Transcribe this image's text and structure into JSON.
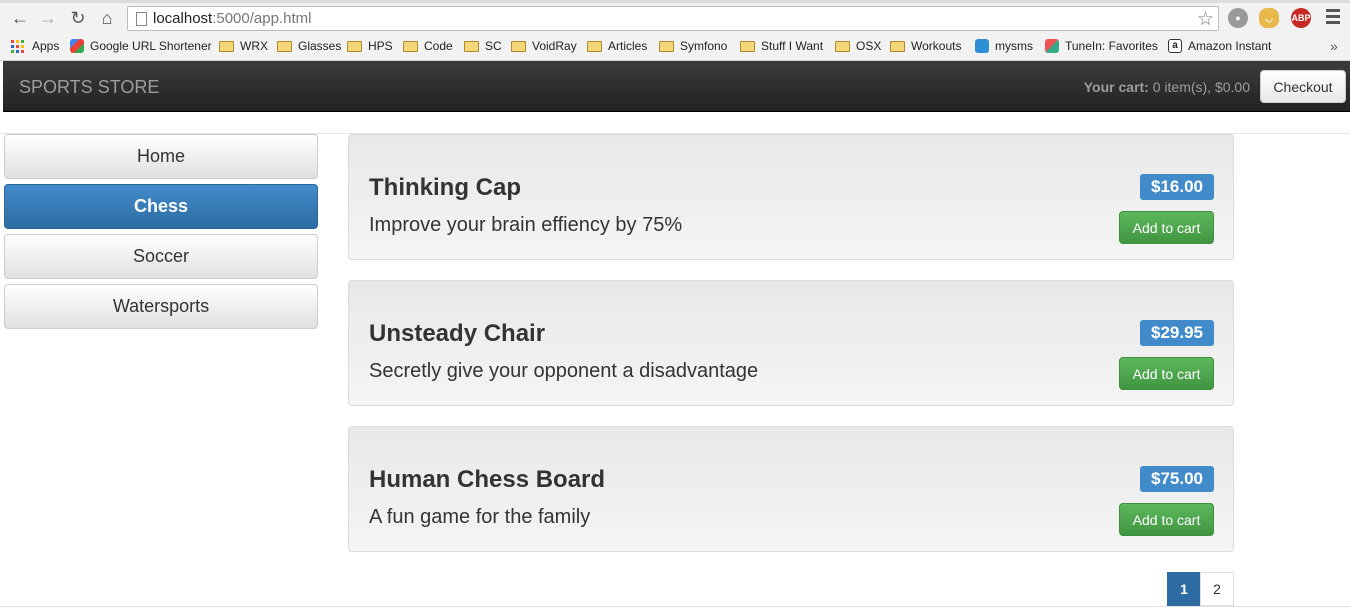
{
  "browser": {
    "url_host": "localhost",
    "url_path": ":5000/app.html",
    "bookmarks": [
      {
        "label": "Apps",
        "icon": "apps-grid-icon"
      },
      {
        "label": "Google URL Shortener",
        "icon": "google-icon"
      },
      {
        "label": "WRX",
        "icon": "folder-icon"
      },
      {
        "label": "Glasses",
        "icon": "folder-icon"
      },
      {
        "label": "HPS",
        "icon": "folder-icon"
      },
      {
        "label": "Code",
        "icon": "folder-icon"
      },
      {
        "label": "SC",
        "icon": "folder-icon"
      },
      {
        "label": "VoidRay",
        "icon": "folder-icon"
      },
      {
        "label": "Articles",
        "icon": "folder-icon"
      },
      {
        "label": "Symfono",
        "icon": "folder-icon"
      },
      {
        "label": "Stuff I Want",
        "icon": "folder-icon"
      },
      {
        "label": "OSX",
        "icon": "folder-icon"
      },
      {
        "label": "Workouts",
        "icon": "folder-icon"
      },
      {
        "label": "mysms",
        "icon": "mysms-icon"
      },
      {
        "label": "TuneIn: Favorites",
        "icon": "tunein-icon"
      },
      {
        "label": "Amazon Instant",
        "icon": "amazon-icon"
      }
    ],
    "extensions": {
      "abp": "ABP"
    },
    "overflow": "»"
  },
  "navbar": {
    "brand": "SPORTS STORE",
    "cart_label": "Your cart:",
    "cart_value": " 0 item(s), $0.00",
    "checkout": "Checkout"
  },
  "categories": [
    {
      "label": "Home",
      "active": false
    },
    {
      "label": "Chess",
      "active": true
    },
    {
      "label": "Soccer",
      "active": false
    },
    {
      "label": "Watersports",
      "active": false
    }
  ],
  "products": [
    {
      "name": "Thinking Cap",
      "description": "Improve your brain effiency by 75%",
      "price": "$16.00",
      "button": "Add to cart"
    },
    {
      "name": "Unsteady Chair",
      "description": "Secretly give your opponent a disadvantage",
      "price": "$29.95",
      "button": "Add to cart"
    },
    {
      "name": "Human Chess Board",
      "description": "A fun game for the family",
      "price": "$75.00",
      "button": "Add to cart"
    }
  ],
  "pagination": [
    {
      "label": "1",
      "active": true
    },
    {
      "label": "2",
      "active": false
    }
  ],
  "colors": {
    "primary": "#428bca",
    "success": "#5cb85c",
    "navbar": "#222222"
  }
}
